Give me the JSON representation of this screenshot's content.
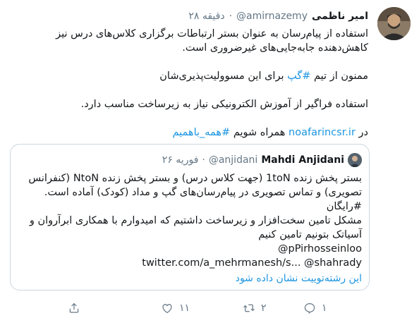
{
  "tweet": {
    "author_name": "امیر ناظمی",
    "author_handle": "@amirnazemy",
    "dot": "·",
    "time": "۲۸ دقیقه",
    "paragraphs": {
      "p1": "استفاده از پیام‌رسان به عنوان بستر ارتباطات برگزاری کلاس‌های درس نیز کاهش‌دهنده جابه‌جایی‌های غیرضروری است.",
      "p2_text": "ممنون از تیم ",
      "p2_hashtag": "#گپ",
      "p2_rest": " برای این مسوولیت‌پذیری‌شان",
      "p3": "استفاده فراگیر از آموزش الکترونیکی نیاز به زیرساخت مناسب دارد.",
      "p4_in": "در ",
      "p4_link": "noafarincsr.ir",
      "p4_mid": " همراه شویم ",
      "p4_hashtag": "#همه_باهمیم"
    }
  },
  "quoted": {
    "author_name": "Mahdi Anjidani",
    "author_handle": "@anjidani",
    "dot": "·",
    "date": "۲۶ فوریه",
    "lines": {
      "l1": "بستر پخش زنده 1toN (جهت کلاس درس) و بستر پخش زنده NtoN (کنفرانس تصویری) و تماس تصویری در پیام‌رسان‌های گپ و مداد (کودک) آماده است. #رایگان",
      "l2": "مشکل تامین سخت‌افزار و زیرساخت داشتیم که امیدوارم با همکاری ابرآروان و آسیاتک بتونیم تامین کنیم",
      "l3": "@pPirhosseinloo",
      "l4": "twitter.com/a_mehrmanesh/s... @shahrady"
    },
    "show_thread": "این رشته‌توییت نشان داده شود"
  },
  "actions": {
    "reply_count": "۱",
    "retweet_count": "۲",
    "like_count": "۱۱",
    "share_count": ""
  },
  "colors": {
    "link": "#1b95e0",
    "muted": "#657786",
    "border": "#ccd6dd"
  }
}
